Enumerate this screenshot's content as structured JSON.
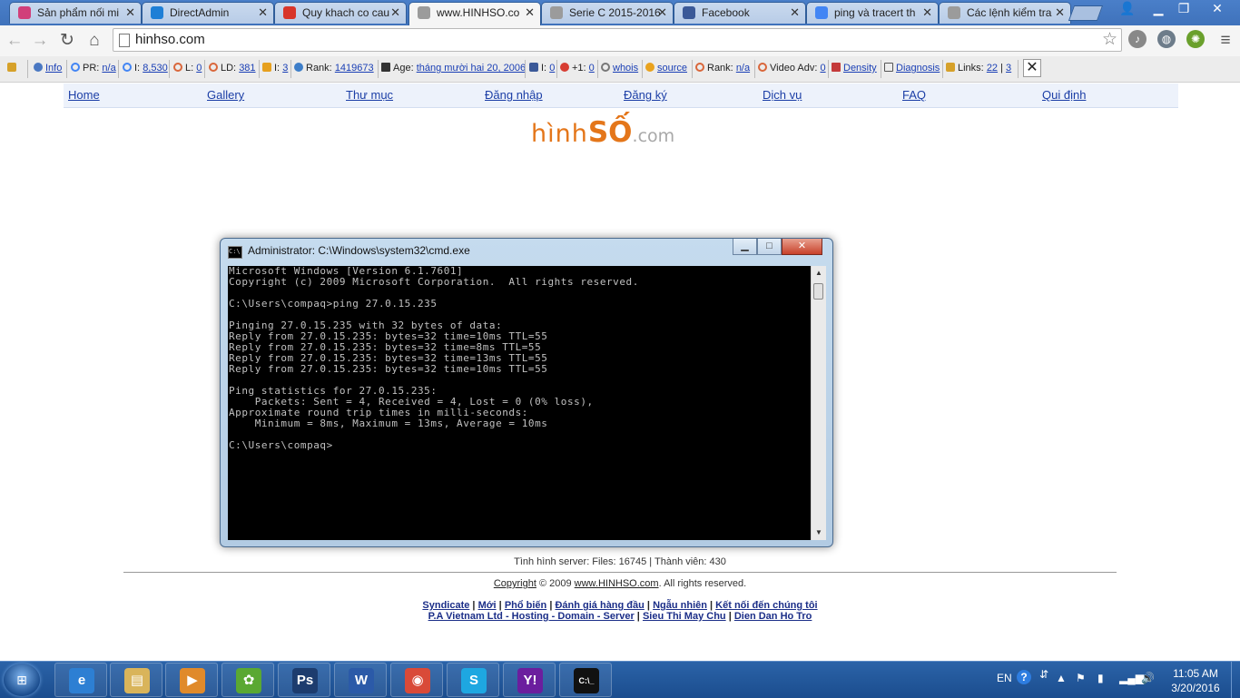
{
  "browser": {
    "tabs": [
      {
        "title": "Sản phẩm nối mi",
        "favicon": "heart-icon",
        "color": "#d13f7a"
      },
      {
        "title": "DirectAdmin",
        "favicon": "directadmin-icon",
        "color": "#1e7fd6"
      },
      {
        "title": "Quy khach co cau",
        "favicon": "gmail-icon",
        "color": "#d8352a"
      },
      {
        "title": "www.HINHSO.co",
        "favicon": "page-icon",
        "color": "#9b9b9b"
      },
      {
        "title": "Serie C 2015-2016",
        "favicon": "page-icon",
        "color": "#9b9b9b"
      },
      {
        "title": "Facebook",
        "favicon": "facebook-icon",
        "color": "#3b5998"
      },
      {
        "title": "ping và tracert th",
        "favicon": "google-icon",
        "color": "#4285f4"
      },
      {
        "title": "Các lệnh kiểm tra",
        "favicon": "page-icon",
        "color": "#9b9b9b"
      }
    ],
    "active_tab_index": 3,
    "url": "hinhso.com"
  },
  "seo_toolbar": {
    "info": "Info",
    "pr_label": "PR:",
    "pr_value": "n/a",
    "i_label": "I:",
    "i_value": "8,530",
    "l_label": "L:",
    "l_value": "0",
    "ld_label": "LD:",
    "ld_value": "381",
    "b_label": "I:",
    "b_value": "3",
    "rank_label": "Rank:",
    "rank_value": "1419673",
    "age_label": "Age:",
    "age_value": "tháng mười hai 20, 2006",
    "fb_label": "I:",
    "fb_value": "0",
    "plus_label": "+1:",
    "plus_value": "0",
    "whois": "whois",
    "source": "source",
    "rank2_label": "Rank:",
    "rank2_value": "n/a",
    "video_label": "Video Adv:",
    "video_value": "0",
    "density": "Density",
    "diagnosis": "Diagnosis",
    "links_label": "Links:",
    "links_value_a": "22",
    "links_value_b": "3"
  },
  "site": {
    "nav": [
      "Home",
      "Gallery",
      "Thư mục",
      "Đăng nhập",
      "Đăng ký",
      "Dịch vụ",
      "FAQ",
      "Qui định"
    ],
    "logo_part1": "hình",
    "logo_part2": "SỐ",
    "logo_part3": ".com",
    "server_stats": "Tình hình server: Files: 16745 | Thành viên: 430",
    "copyright_link": "Copyright",
    "copyright_mid": "© 2009",
    "site_link": "www.HINHSO.com",
    "copyright_end": ". All rights reserved.",
    "footer_links_row1": [
      "Syndicate",
      "Mới",
      "Phổ biến",
      "Đánh giá hàng đầu",
      "Ngẫu nhiên",
      "Kết nối đến chúng tôi"
    ],
    "footer_links_row2": [
      "P.A Vietnam Ltd - Hosting - Domain - Server",
      "Sieu Thi May Chu",
      "Dien Dan Ho Tro"
    ]
  },
  "cmd": {
    "title": "Administrator: C:\\Windows\\system32\\cmd.exe",
    "icon_text": "C:\\",
    "lines": [
      "Microsoft Windows [Version 6.1.7601]",
      "Copyright (c) 2009 Microsoft Corporation.  All rights reserved.",
      "",
      "C:\\Users\\compaq>ping 27.0.15.235",
      "",
      "Pinging 27.0.15.235 with 32 bytes of data:",
      "Reply from 27.0.15.235: bytes=32 time=10ms TTL=55",
      "Reply from 27.0.15.235: bytes=32 time=8ms TTL=55",
      "Reply from 27.0.15.235: bytes=32 time=13ms TTL=55",
      "Reply from 27.0.15.235: bytes=32 time=10ms TTL=55",
      "",
      "Ping statistics for 27.0.15.235:",
      "    Packets: Sent = 4, Received = 4, Lost = 0 (0% loss),",
      "Approximate round trip times in milli-seconds:",
      "    Minimum = 8ms, Maximum = 13ms, Average = 10ms",
      "",
      "C:\\Users\\compaq>"
    ]
  },
  "taskbar": {
    "apps": [
      {
        "name": "internet-explorer-icon",
        "glyph": "e",
        "color": "#2d7fd3"
      },
      {
        "name": "file-explorer-icon",
        "glyph": "▤",
        "color": "#d9b45a"
      },
      {
        "name": "media-player-icon",
        "glyph": "▶",
        "color": "#e08a2a"
      },
      {
        "name": "green-app-icon",
        "glyph": "✿",
        "color": "#5aa832"
      },
      {
        "name": "photoshop-icon",
        "glyph": "Ps",
        "color": "#1d3c6e"
      },
      {
        "name": "word-icon",
        "glyph": "W",
        "color": "#2b5aa8"
      },
      {
        "name": "chrome-icon",
        "glyph": "◉",
        "color": "#d94a38"
      },
      {
        "name": "skype-icon",
        "glyph": "S",
        "color": "#1ea7e1"
      },
      {
        "name": "yahoo-messenger-icon",
        "glyph": "Y!",
        "color": "#6b1e9e"
      },
      {
        "name": "cmd-icon",
        "glyph": "C:\\_",
        "color": "#111111"
      }
    ],
    "language": "EN",
    "time": "11:05 AM",
    "date": "3/20/2016"
  }
}
